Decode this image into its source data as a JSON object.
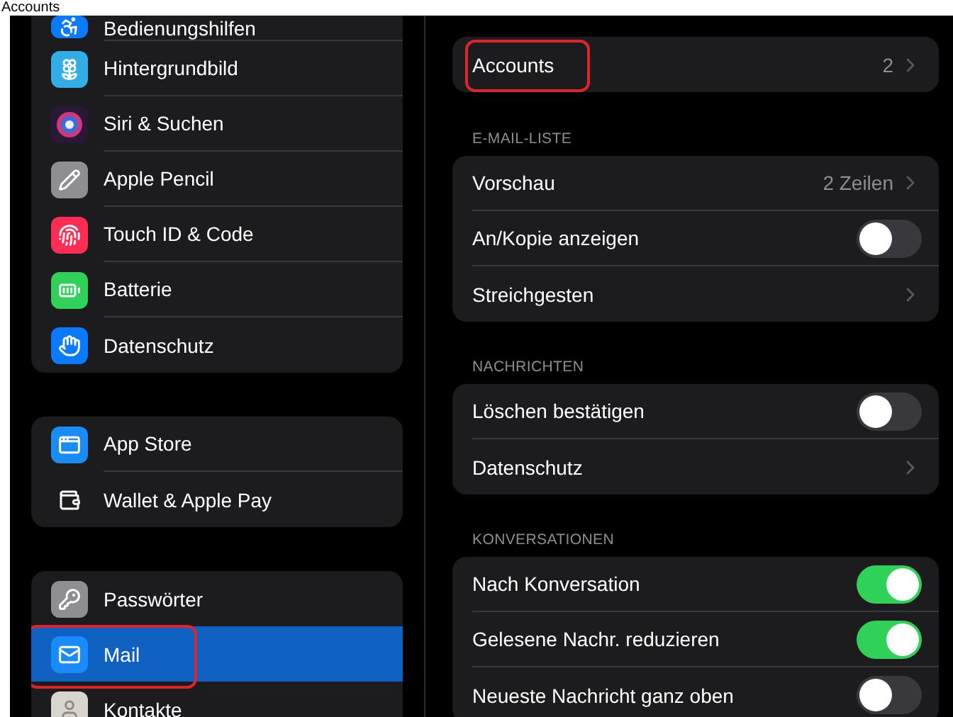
{
  "top_strip": {
    "title": "Accounts"
  },
  "sidebar": {
    "groups": [
      {
        "items": [
          {
            "label": "Bedienungshilfen",
            "selected": false,
            "highlighted": false,
            "partial": true
          },
          {
            "label": "Hintergrundbild",
            "selected": false,
            "highlighted": false
          },
          {
            "label": "Siri & Suchen",
            "selected": false,
            "highlighted": false
          },
          {
            "label": "Apple Pencil",
            "selected": false,
            "highlighted": false
          },
          {
            "label": "Touch ID & Code",
            "selected": false,
            "highlighted": false
          },
          {
            "label": "Batterie",
            "selected": false,
            "highlighted": false
          },
          {
            "label": "Datenschutz",
            "selected": false,
            "highlighted": false
          }
        ]
      },
      {
        "items": [
          {
            "label": "App Store",
            "selected": false,
            "highlighted": false
          },
          {
            "label": "Wallet & Apple Pay",
            "selected": false,
            "highlighted": false
          }
        ]
      },
      {
        "items": [
          {
            "label": "Passwörter",
            "selected": false,
            "highlighted": false
          },
          {
            "label": "Mail",
            "selected": true,
            "highlighted": true
          },
          {
            "label": "Kontakte",
            "selected": false,
            "highlighted": false
          }
        ]
      }
    ]
  },
  "detail": {
    "sections": [
      {
        "rows": [
          {
            "kind": "link",
            "label": "Accounts",
            "value": "2",
            "highlighted": true
          }
        ]
      },
      {
        "header": "E-MAIL-LISTE",
        "rows": [
          {
            "kind": "link",
            "label": "Vorschau",
            "value": "2 Zeilen",
            "highlighted": false
          },
          {
            "kind": "toggle",
            "label": "An/Kopie anzeigen",
            "on": false,
            "highlighted": false
          },
          {
            "kind": "link",
            "label": "Streichgesten",
            "highlighted": false
          }
        ]
      },
      {
        "header": "NACHRICHTEN",
        "rows": [
          {
            "kind": "toggle",
            "label": "Löschen bestätigen",
            "on": false,
            "highlighted": false
          },
          {
            "kind": "link",
            "label": "Datenschutz",
            "highlighted": false
          }
        ]
      },
      {
        "header": "KONVERSATIONEN",
        "rows": [
          {
            "kind": "toggle",
            "label": "Nach Konversation",
            "on": true,
            "highlighted": false
          },
          {
            "kind": "toggle",
            "label": "Gelesene Nachr. reduzieren",
            "on": true,
            "highlighted": false
          },
          {
            "kind": "toggle",
            "label": "Neueste Nachricht ganz oben",
            "on": false,
            "highlighted": false
          }
        ]
      }
    ]
  }
}
